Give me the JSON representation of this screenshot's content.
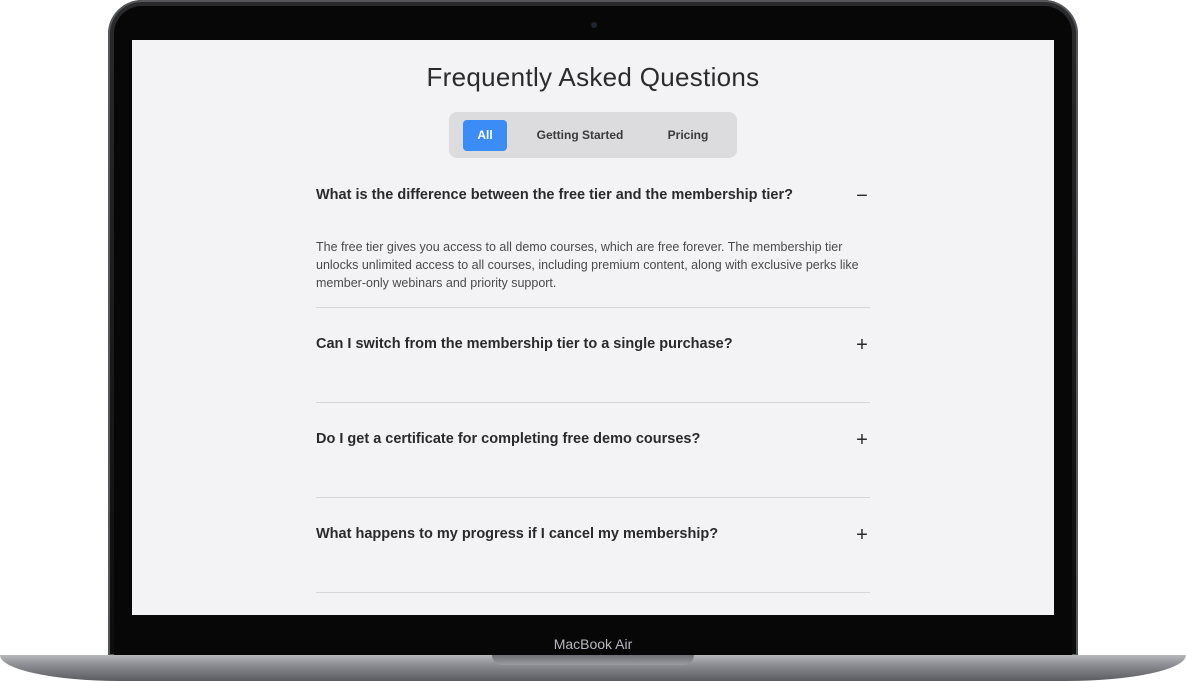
{
  "device": {
    "label": "MacBook Air"
  },
  "faq": {
    "title": "Frequently Asked Questions",
    "tabs": [
      {
        "label": "All",
        "active": true
      },
      {
        "label": "Getting Started",
        "active": false
      },
      {
        "label": "Pricing",
        "active": false
      }
    ],
    "items": [
      {
        "question": "What is the difference between the free tier and the membership tier?",
        "answer": "The free tier gives you access to all demo courses, which are free forever. The membership tier unlocks unlimited access to all courses, including premium content, along with exclusive perks like member-only webinars and priority support.",
        "toggle": "−",
        "expanded": true
      },
      {
        "question": "Can I switch from the membership tier to a single purchase?",
        "toggle": "+",
        "expanded": false
      },
      {
        "question": "Do I get a certificate for completing free demo courses?",
        "toggle": "+",
        "expanded": false
      },
      {
        "question": "What happens to my progress if I cancel my membership?",
        "toggle": "+",
        "expanded": false
      }
    ]
  },
  "colors": {
    "accent": "#3b8cf5",
    "screen_bg": "#f3f3f5",
    "tab_bar_bg": "#dcdcde"
  }
}
